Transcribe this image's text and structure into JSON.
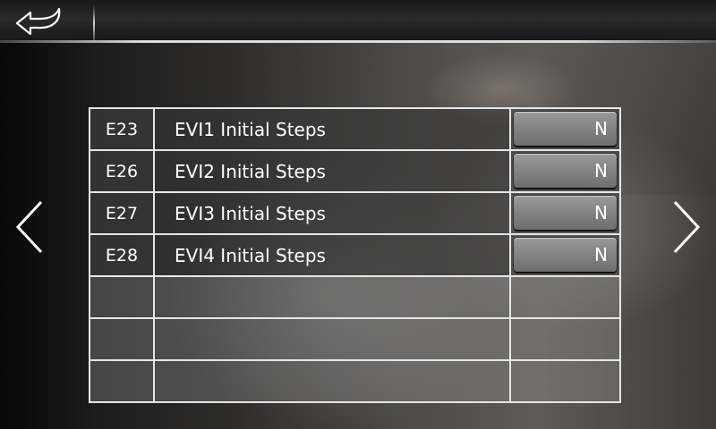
{
  "table": {
    "rows": [
      {
        "code": "E23",
        "name": "EVI1 Initial Steps",
        "value": "N"
      },
      {
        "code": "E26",
        "name": "EVI2 Initial Steps",
        "value": "N"
      },
      {
        "code": "E27",
        "name": "EVI3 Initial Steps",
        "value": "N"
      },
      {
        "code": "E28",
        "name": "EVI4 Initial Steps",
        "value": "N"
      }
    ]
  },
  "icons": {
    "back": "back-arrow-icon",
    "prev": "chevron-left-icon",
    "next": "chevron-right-icon"
  },
  "colors": {
    "grid_line": "#e6e6e6",
    "value_button": "#858585",
    "text": "#ffffff"
  }
}
